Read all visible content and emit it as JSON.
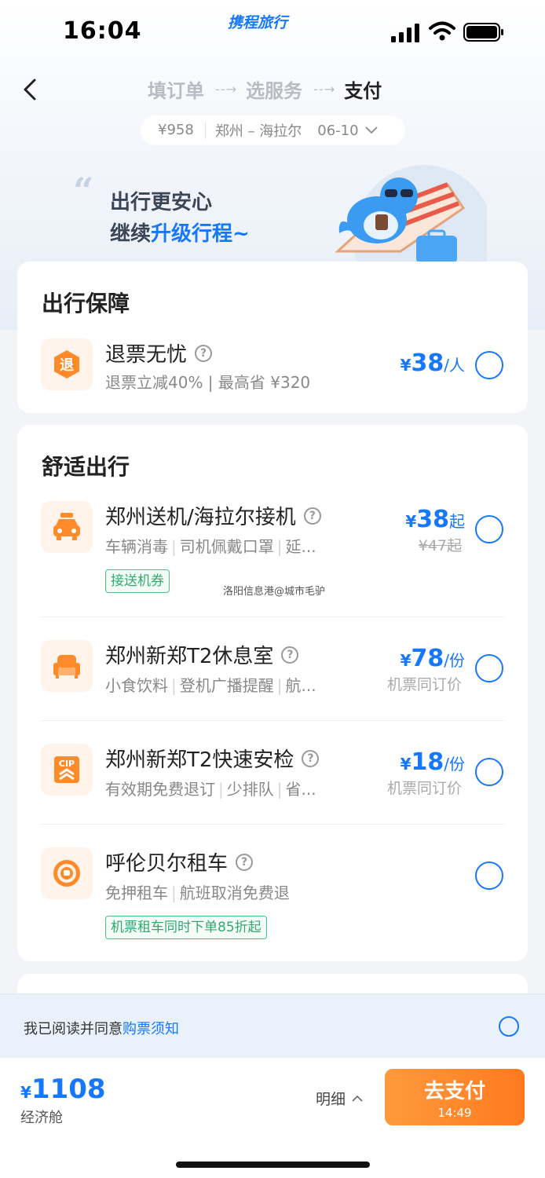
{
  "status_bar": {
    "time": "16:04",
    "brand": "携程旅行"
  },
  "nav": {
    "steps": [
      {
        "label": "填订单",
        "state": "done"
      },
      {
        "label": "选服务",
        "state": "done"
      },
      {
        "label": "支付",
        "state": "current"
      }
    ]
  },
  "trip": {
    "price": "¥958",
    "route": "郑州 – 海拉尔",
    "date": "06-10"
  },
  "banner": {
    "line1": "出行更安心",
    "line2_prefix": "继续",
    "line2_highlight": "升级行程",
    "line2_suffix": "~"
  },
  "guarantee": {
    "title": "出行保障",
    "items": [
      {
        "icon": "refund-icon",
        "icon_text": "退",
        "name": "退票无忧",
        "desc": "退票立减40% | 最高省 ¥320",
        "price_yen": "¥",
        "price": "38",
        "unit": "/人"
      }
    ]
  },
  "comfort": {
    "title": "舒适出行",
    "items": [
      {
        "icon": "car-icon",
        "name": "郑州送机/海拉尔接机",
        "desc": [
          "车辆消毒",
          "司机佩戴口罩",
          "延..."
        ],
        "price_yen": "¥",
        "price": "38",
        "unit": "起",
        "sub": "¥47起",
        "tag": "接送机券"
      },
      {
        "icon": "sofa-icon",
        "name": "郑州新郑T2休息室",
        "desc": [
          "小食饮料",
          "登机广播提醒",
          "航..."
        ],
        "price_yen": "¥",
        "price": "78",
        "unit": "/份",
        "sub": "机票同订价"
      },
      {
        "icon": "cip-icon",
        "icon_text": "CIP",
        "name": "郑州新郑T2快速安检",
        "desc": [
          "有效期免费退订",
          "少排队",
          "省..."
        ],
        "price_yen": "¥",
        "price": "18",
        "unit": "/份",
        "sub": "机票同订价"
      },
      {
        "icon": "steering-wheel-icon",
        "name": "呼伦贝尔租车",
        "desc": [
          "免押租车",
          "航班取消免费退"
        ],
        "tag": "机票租车同时下单85折起"
      }
    ]
  },
  "watermark": "洛阳信息港@城市毛驴",
  "agreement": {
    "prefix": "我已阅读并同意",
    "link": "购票须知"
  },
  "footer": {
    "total_yen": "¥",
    "total": "1108",
    "cabin": "经济舱",
    "detail": "明细",
    "pay_label": "去支付",
    "countdown": "14:49"
  },
  "colors": {
    "accent": "#1677ff",
    "pay": "#ff8a2a",
    "tag_green": "#2eaa6e",
    "icon_orange": "#ff8a2a"
  }
}
